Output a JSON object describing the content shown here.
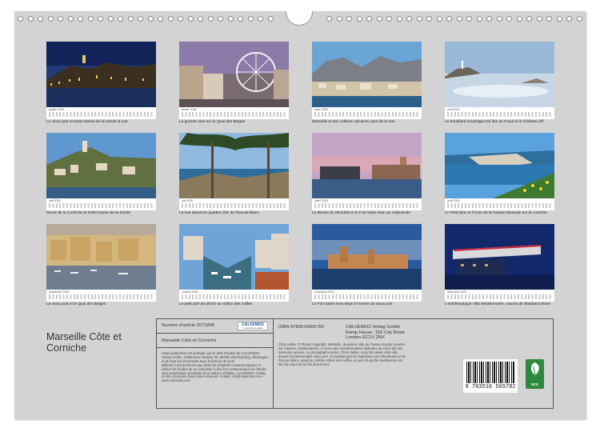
{
  "calendar": {
    "title": "Marseille Côte et Corniche",
    "cards": [
      {
        "month": "janvier 2026",
        "caption": "Le vieux port et Notre-Dame-de-la-Garde la nuit"
      },
      {
        "month": "février 2026",
        "caption": "La grande roue sur le Quai des Belges"
      },
      {
        "month": "mars 2026",
        "caption": "Marseille et ses collines calcaires vues de la mer"
      },
      {
        "month": "avril 2026",
        "caption": "Le brouillard enveloppe les îles du Frioul et le Château d'If"
      },
      {
        "month": "mai 2026",
        "caption": "Route de la Corniche et Notre-Dame-de-la-Garde"
      },
      {
        "month": "juin 2026",
        "caption": "La vue depuis le quartier chic du Roucas Blanc"
      },
      {
        "month": "juillet 2026",
        "caption": "Le Musée du MUCEM et le Fort Saint-Jean au crépuscule"
      },
      {
        "month": "août 2026",
        "caption": "Le Petit Nice et l'Anse de la Fausse Monnaie sur la corniche"
      },
      {
        "month": "septembre 2026",
        "caption": "Le vieux port et le Quai des Belges"
      },
      {
        "month": "octobre 2026",
        "caption": "Le petit port de pêche au Vallon des Auffes"
      },
      {
        "month": "novembre 2026",
        "caption": "Le Fort Saint-Jean situé à l'entrée du vieux port"
      },
      {
        "month": "décembre 2026",
        "caption": "L'emblématique Villa Méditerranée, oeuvre de Stephano Boeri"
      }
    ]
  },
  "info": {
    "article_label": "Numéro d'article 2071806",
    "logo": "CALVENDO",
    "logo_sub": "Le calendrier de qualité",
    "product_title": "Marseille Côte et Corniche",
    "copyright_text": "Cette publication est protégée par le droit d'auteur de CALVENDO Verlag GmbH, Gildbrunner Strasse 38, 82008 Unterhaching, Allemagne, et de tous les documents sous la licence de leurs tailleurs.Conformément aux droits de propriété existants séparer et utiliser les feuilles de ce calendrier à des fins commerciales est interdit sans autorisation préalable de la maison d'édition. CALVENDO Verlag GmbH. Données sous toutes réserves. E-Mail: info@calvendo.com • www.calvendo.com",
    "isbn": "ISBN 9783516565782",
    "publisher": [
      "CALVENDO Verlag GmbH",
      "Kemp House, 152 City Road",
      "London EC1V 2NX"
    ],
    "photographer_text": "Chris Hellier © Photos copyright. Marseille, deuxième ville de France et porte ouverte sur l'espace méditerranéen, a connu des transformations radicales au cours des dix dernières années. Le photographe primé, Chris Hellier, nous fait visiter cette ville depuis l'incontournable vieux port, en passant par les superbes rues d'Endoume et du Roucas Blanc, jusqu'au célèbre Vallon des Auffes, un port de pêche traditionnel non loin du coeur de la cité phocéenne.",
    "barcode_number": "9 783516 565782",
    "eco_label": "eco"
  }
}
